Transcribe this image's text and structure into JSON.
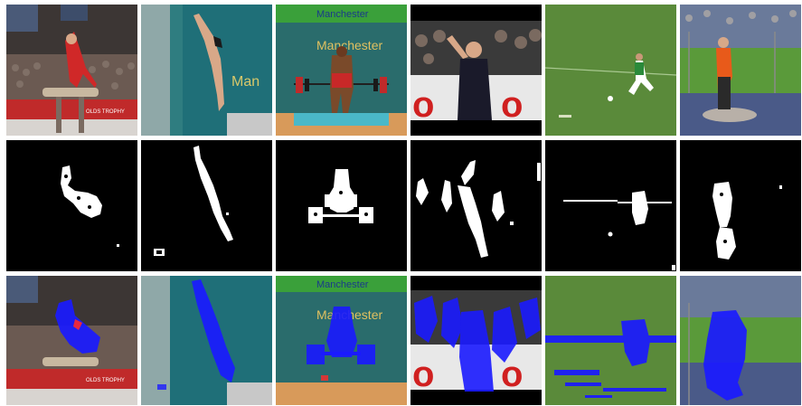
{
  "figure": {
    "rows": [
      {
        "name": "original-frames"
      },
      {
        "name": "motion-masks"
      },
      {
        "name": "trajectory-overlays"
      }
    ],
    "columns": [
      {
        "name": "pommel-horse",
        "signage": [
          "OLDS TROPHY"
        ]
      },
      {
        "name": "diving",
        "signage": [
          "Man"
        ]
      },
      {
        "name": "weightlifting",
        "signage": [
          "Manchester",
          "Manchester"
        ]
      },
      {
        "name": "running",
        "signage": [
          "o",
          "o"
        ]
      },
      {
        "name": "football",
        "signage": []
      },
      {
        "name": "hammer-throw",
        "signage": []
      }
    ]
  },
  "colors": {
    "mask_bg": "#000000",
    "mask_fg": "#ffffff",
    "overlay_blue": "#1a1aff",
    "overlay_red": "#ff2a2a"
  }
}
